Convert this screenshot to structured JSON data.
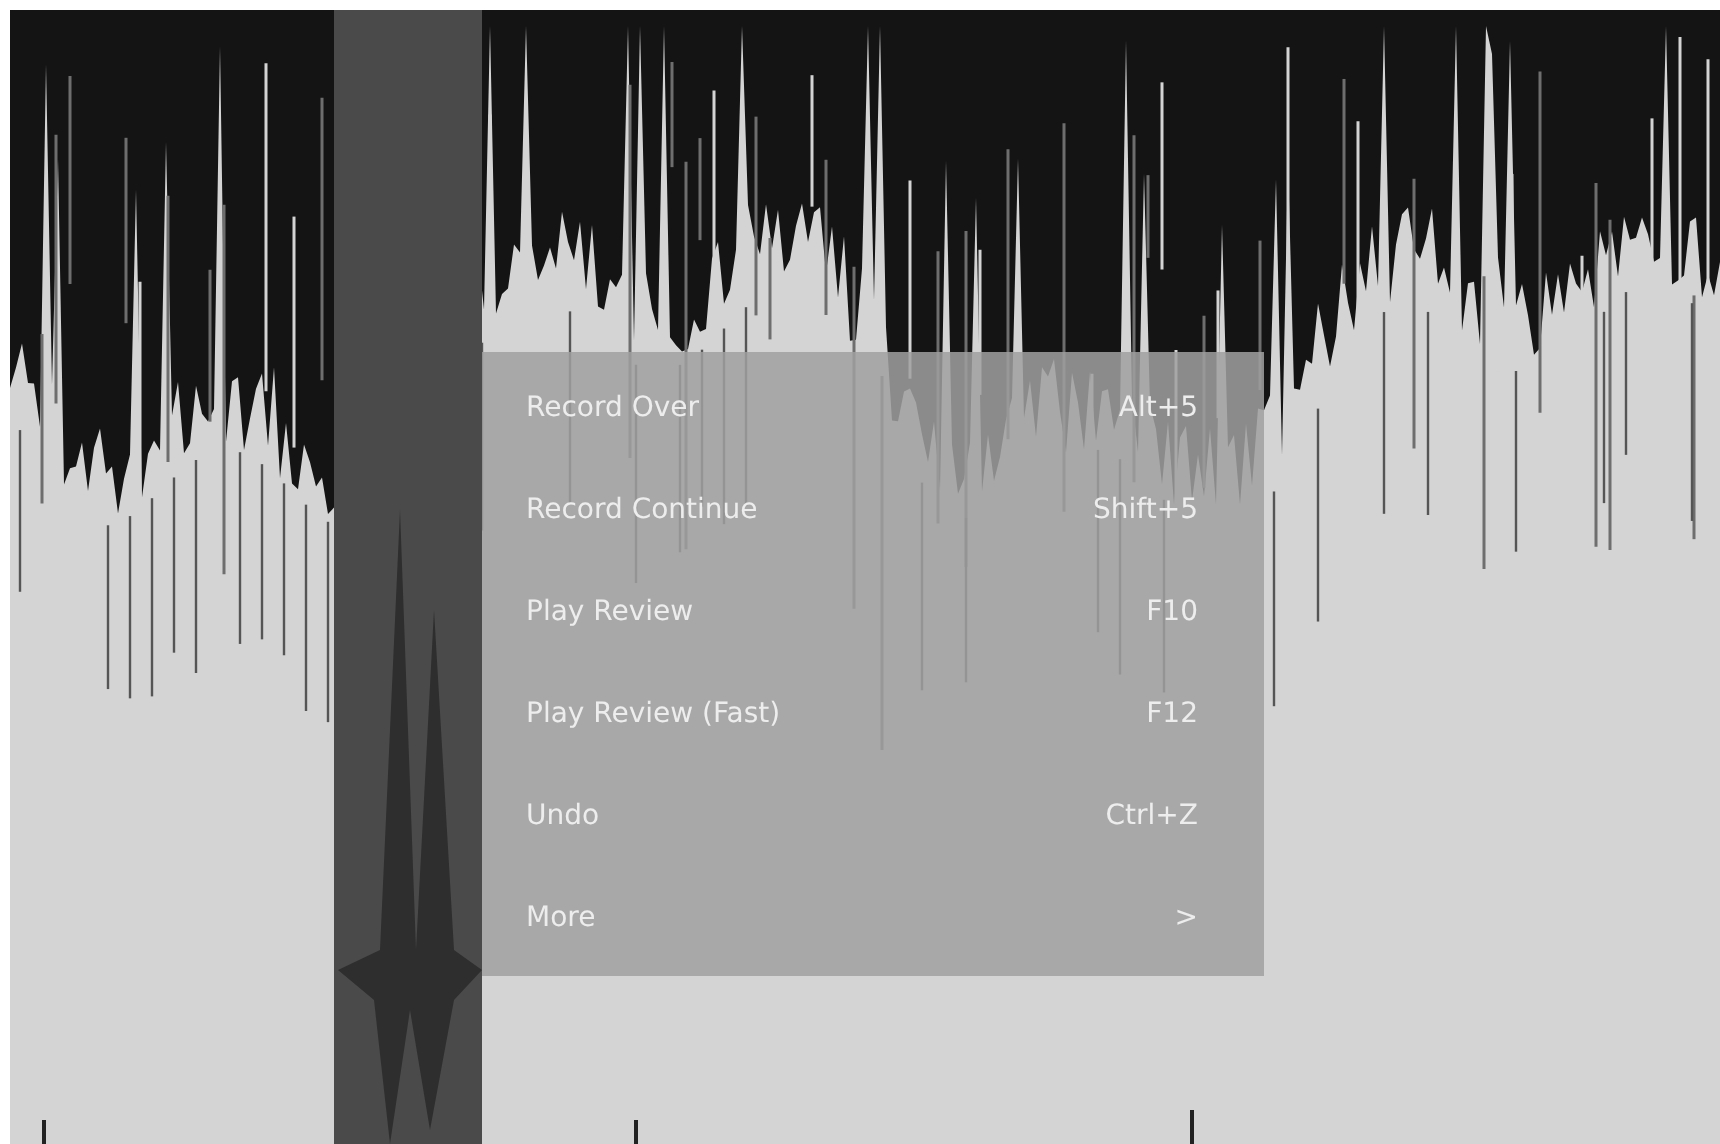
{
  "menu": {
    "items": [
      {
        "label": "Record Over",
        "shortcut": "Alt+5"
      },
      {
        "label": "Record Continue",
        "shortcut": "Shift+5"
      },
      {
        "label": "Play Review",
        "shortcut": "F10"
      },
      {
        "label": "Play Review (Fast)",
        "shortcut": "F12"
      },
      {
        "label": "Undo",
        "shortcut": "Ctrl+Z"
      },
      {
        "label": "More",
        "shortcut": ">"
      }
    ]
  }
}
